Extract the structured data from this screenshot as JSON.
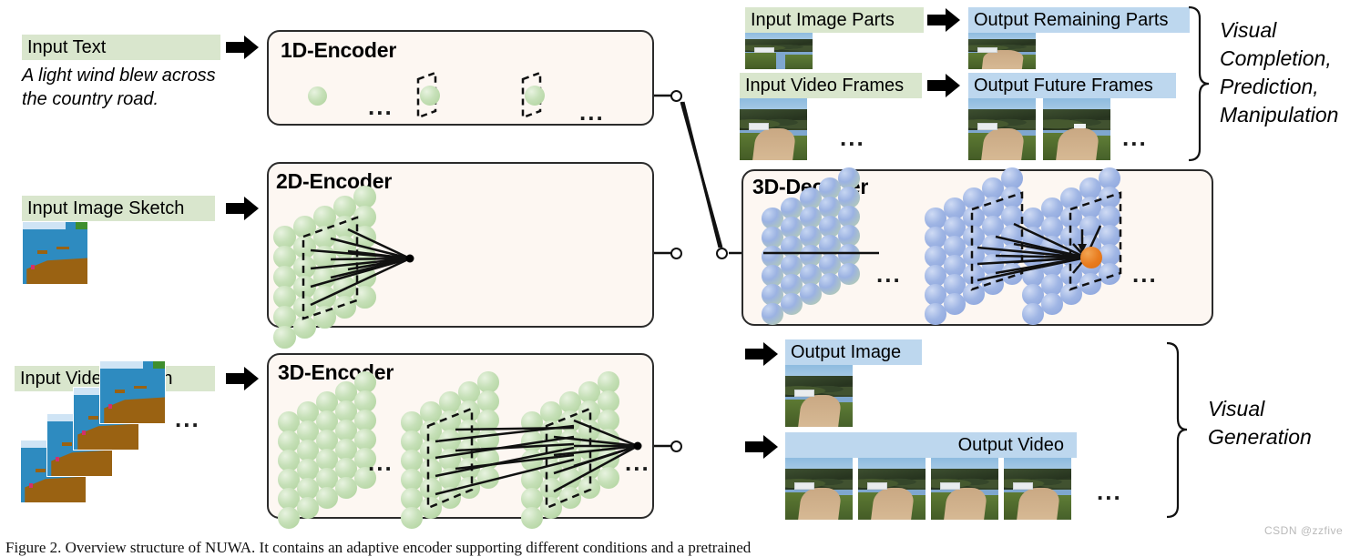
{
  "figure": {
    "caption": "Figure 2. Overview structure of NUWA. It contains an adaptive encoder supporting different conditions and a pretrained",
    "watermark": "CSDN @zzfive"
  },
  "inputs": {
    "text": {
      "label": "Input Text",
      "sample": "A light wind blew across the country road."
    },
    "image_sketch": {
      "label": "Input Image Sketch"
    },
    "video_sketch": {
      "label": "Input Video Sketch",
      "ellipsis": "..."
    }
  },
  "encoders": [
    {
      "title": "1D-Encoder",
      "ellipsis": "..."
    },
    {
      "title": "2D-Encoder",
      "ellipsis": "..."
    },
    {
      "title": "3D-Encoder",
      "ellipsis": "..."
    }
  ],
  "decoder": {
    "title": "3D-Decoder",
    "ellipsis": "..."
  },
  "completion_group": {
    "caption": "Visual Completion, Prediction, Manipulation",
    "caption_lines": [
      "Visual",
      "Completion,",
      "Prediction,",
      "Manipulation"
    ],
    "rows": [
      {
        "input_label": "Input Image Parts",
        "output_label": "Output Remaining Parts",
        "ellipsis": "..."
      },
      {
        "input_label": "Input Video Frames",
        "output_label": "Output Future Frames",
        "ellipsis": "..."
      }
    ]
  },
  "generation_group": {
    "caption": "Visual Generation",
    "caption_lines": [
      "Visual",
      "Generation"
    ],
    "rows": [
      {
        "output_label": "Output Image"
      },
      {
        "output_label": "Output Video",
        "ellipsis": "..."
      }
    ]
  },
  "icons": {
    "arrow": "right-arrow-icon",
    "brace": "curly-brace-icon",
    "connector": "connector-circle-icon"
  },
  "colors": {
    "input_chip": "#d9e6cd",
    "output_chip": "#bdd7ee",
    "panel_bg": "#fdf7f2",
    "panel_border": "#2b2b2b",
    "sphere_green": "#aed29b",
    "sphere_blue": "#8aa3dc",
    "highlight_orange": "#e87b1e"
  }
}
